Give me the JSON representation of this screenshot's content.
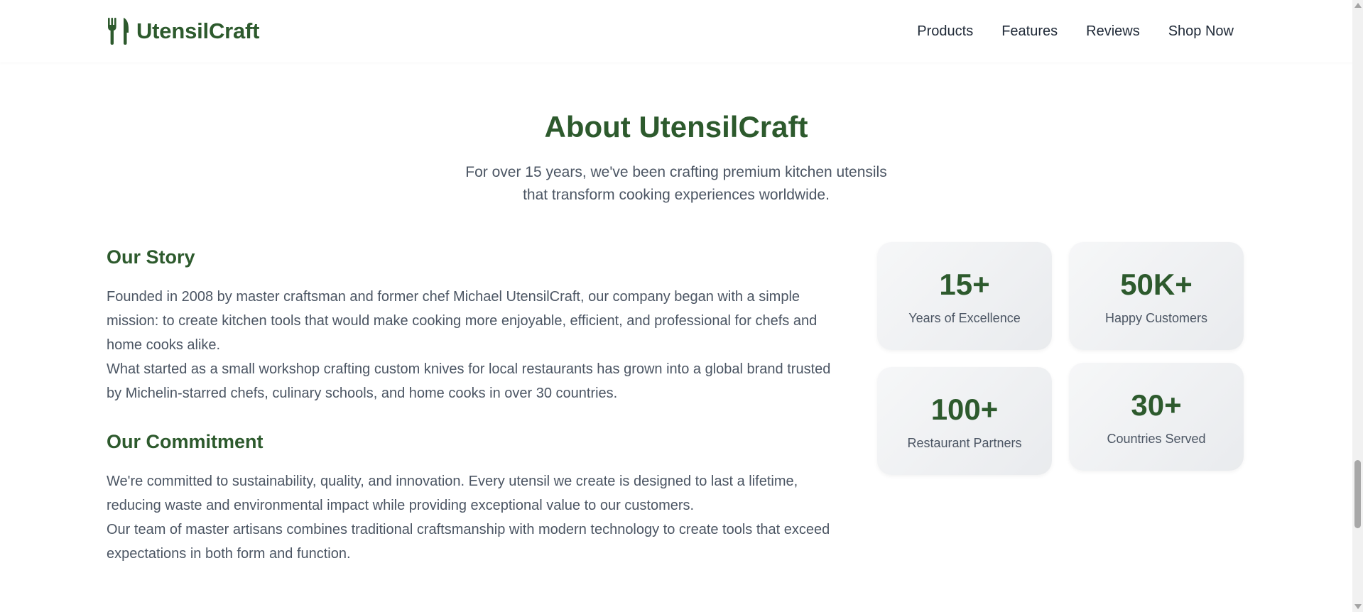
{
  "header": {
    "brand_name": "UtensilCraft",
    "brand_icon": "fork-knife-icon",
    "nav": [
      {
        "label": "Products"
      },
      {
        "label": "Features"
      },
      {
        "label": "Reviews"
      },
      {
        "label": "Shop Now"
      }
    ]
  },
  "about": {
    "title": "About UtensilCraft",
    "subtitle_line1": "For over 15 years, we've been crafting premium kitchen utensils",
    "subtitle_line2": "that transform cooking experiences worldwide.",
    "story": {
      "heading": "Our Story",
      "paragraph1": "Founded in 2008 by master craftsman and former chef Michael UtensilCraft, our company began with a simple mission: to create kitchen tools that would make cooking more enjoyable, efficient, and professional for chefs and home cooks alike.",
      "paragraph2": "What started as a small workshop crafting custom knives for local restaurants has grown into a global brand trusted by Michelin-starred chefs, culinary schools, and home cooks in over 30 countries."
    },
    "commitment": {
      "heading": "Our Commitment",
      "paragraph1": "We're committed to sustainability, quality, and innovation. Every utensil we create is designed to last a lifetime, reducing waste and environmental impact while providing exceptional value to our customers.",
      "paragraph2": "Our team of master artisans combines traditional craftsmanship with modern technology to create tools that exceed expectations in both form and function."
    },
    "stats": [
      {
        "value": "15+",
        "label": "Years of Excellence"
      },
      {
        "value": "50K+",
        "label": "Happy Customers"
      },
      {
        "value": "100+",
        "label": "Restaurant Partners"
      },
      {
        "value": "30+",
        "label": "Countries Served"
      }
    ]
  },
  "colors": {
    "brand_green": "#2d5a2d",
    "text_gray": "#4b5563",
    "nav_text": "#1f2937"
  }
}
